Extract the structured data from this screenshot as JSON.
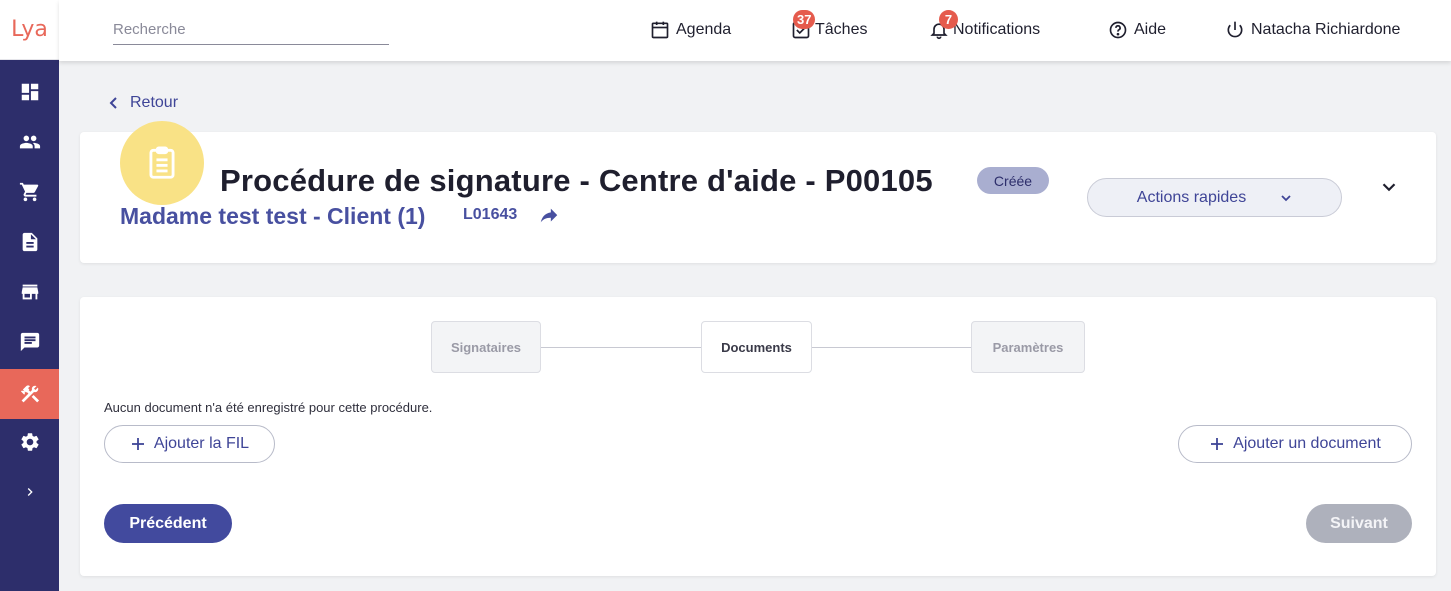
{
  "app": {
    "logo_text": "Lya",
    "accent_color": "#e8685a",
    "sidebar_color": "#2d2e6b",
    "primary_color": "#424a9e"
  },
  "sidebar": {
    "items": [
      {
        "icon": "dashboard-icon"
      },
      {
        "icon": "people-icon"
      },
      {
        "icon": "cart-icon"
      },
      {
        "icon": "document-icon"
      },
      {
        "icon": "store-icon"
      },
      {
        "icon": "chat-icon"
      },
      {
        "icon": "tools-icon",
        "active": true
      },
      {
        "icon": "settings-icon"
      },
      {
        "icon": "expand-chevron-icon"
      }
    ]
  },
  "topbar": {
    "search": {
      "placeholder": "Recherche",
      "value": ""
    },
    "agenda": {
      "label": "Agenda",
      "icon": "calendar-icon"
    },
    "tasks": {
      "label": "Tâches",
      "badge": "37",
      "icon": "checkbox-icon"
    },
    "notifications": {
      "label": "Notifications",
      "badge": "7",
      "icon": "bell-icon"
    },
    "help": {
      "label": "Aide",
      "icon": "help-circle-icon"
    },
    "user": {
      "label": "Natacha Richiardone",
      "icon": "power-icon"
    }
  },
  "back": {
    "label": "Retour"
  },
  "header": {
    "title": "Procédure de signature - Centre d'aide - P00105",
    "status": "Créée",
    "client": "Madame test test - Client (1)",
    "reference": "L01643",
    "quick_actions_label": "Actions rapides"
  },
  "stepper": {
    "steps": [
      {
        "label": "Signataires",
        "state": "inactive"
      },
      {
        "label": "Documents",
        "state": "active"
      },
      {
        "label": "Paramètres",
        "state": "inactive"
      }
    ]
  },
  "documents": {
    "empty_message": "Aucun document n'a été enregistré pour cette procédure.",
    "add_fil_label": "Ajouter la FIL",
    "add_document_label": "Ajouter un document"
  },
  "footer": {
    "previous_label": "Précédent",
    "next_label": "Suivant"
  }
}
